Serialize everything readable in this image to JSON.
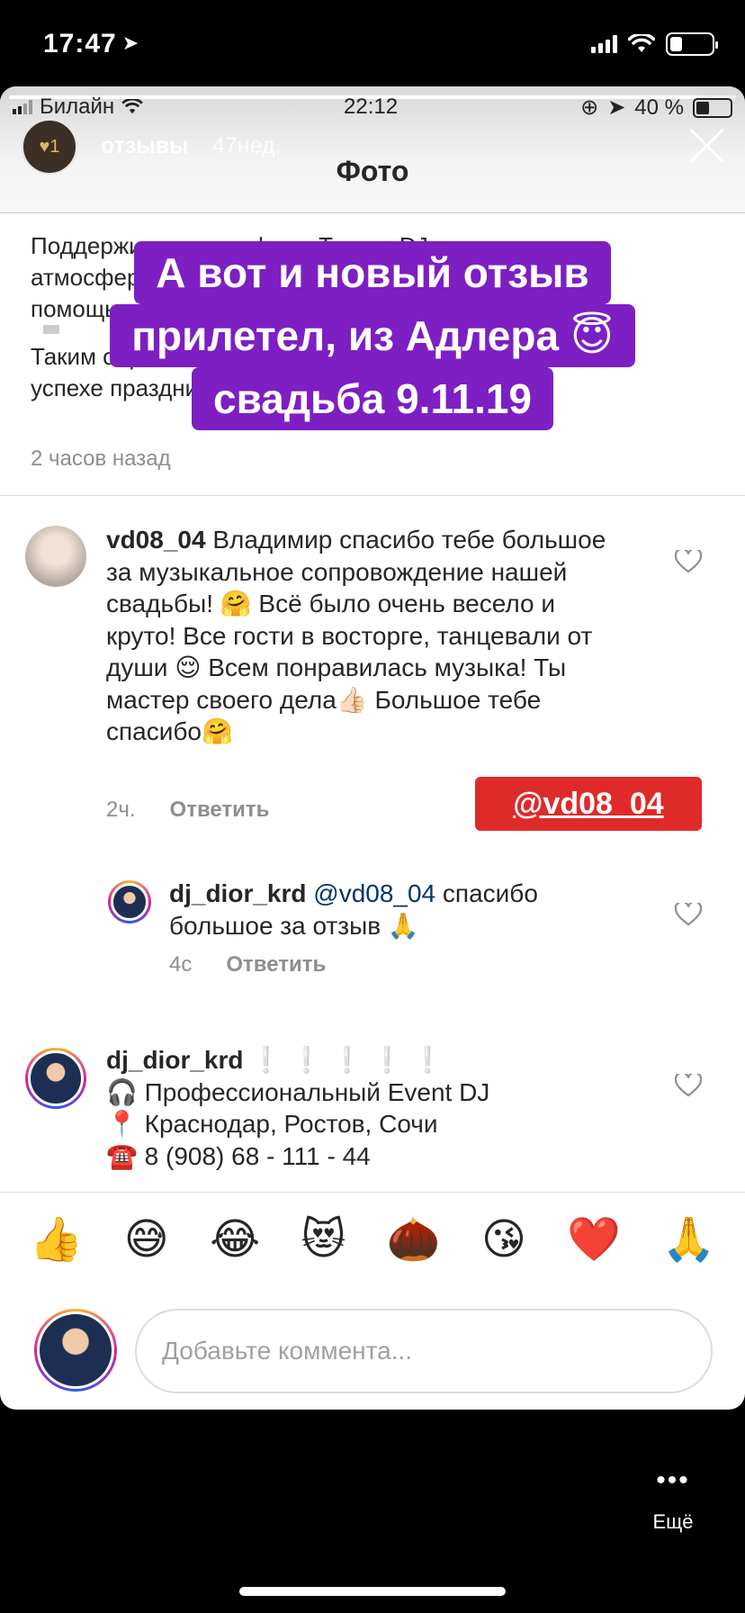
{
  "outer_status": {
    "time": "17:47",
    "colors": {
      "background": "#000000",
      "text": "#ffffff"
    }
  },
  "inner_status": {
    "carrier": "Билайн",
    "time": "22:12",
    "battery": "40 %"
  },
  "story": {
    "username": "отзывы",
    "age": "47нед.",
    "title": "Фото",
    "progress": 0.95
  },
  "previous_comment": {
    "lines": [
      "Поддерживал атмосферу. Только DJ создает",
      "атмосферу праздника и заряжает гостей с",
      "помощью музыки."
    ],
    "lines2": [
      "Таким образом DJ играет главную роль в",
      "успехе праздника и всего мероприятия."
    ],
    "time": "2 часов назад"
  },
  "caption": {
    "line1": "А вот и новый отзыв",
    "line2": "прилетел, из Адлера 😇",
    "line3": "свадьба 9.11.19",
    "color": "#7d1fc2"
  },
  "comments": [
    {
      "user": "vd08_04",
      "text": "Владимир спасибо тебе большое за музыкальное сопровождение нашей свадьбы! 🤗 Всё было очень весело и круто! Все гости в восторге, танцевали от души 😌 Всем понравилась музыка! Ты мастер своего дела👍🏻 Большое тебе спасибо🤗",
      "time": "2ч.",
      "reply": "Ответить"
    },
    {
      "user": "dj_dior_krd",
      "mention": "@vd08_04",
      "text": "спасибо большое за отзыв 🙏",
      "time": "4с",
      "reply": "Ответить"
    },
    {
      "user": "dj_dior_krd",
      "marks": "❕❕❕❕❕",
      "line1": "🎧 Профессиональный Event DJ",
      "line2": "📍 Краснодар, Ростов, Сочи",
      "line3": "☎️ 8 (908) 68 - 111 - 44"
    }
  ],
  "tag": {
    "text": "@vd08_04",
    "color": "#df2a2a"
  },
  "emoji_bar": [
    "👍",
    "😅",
    "😂",
    "😻",
    "🌰",
    "😘",
    "❤️",
    "🙏"
  ],
  "composer": {
    "placeholder": "Добавьте коммента..."
  },
  "more": {
    "label": "Ещё"
  },
  "icons": [
    "location-arrow-icon",
    "signal-icon",
    "wifi-icon",
    "battery-icon",
    "close-icon",
    "heart-icon",
    "more-dots-icon"
  ]
}
